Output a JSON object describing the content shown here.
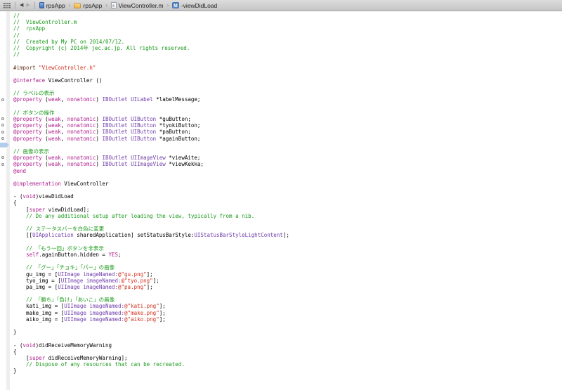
{
  "jumpbar": {
    "related_items_icon": "grid-icon",
    "back_label": "◀",
    "forward_label": "▶",
    "separator": "›",
    "file_icon_letter": "m",
    "method_icon_letter": "M",
    "breadcrumb": [
      {
        "icon": "project-icon",
        "label": "rpsApp"
      },
      {
        "icon": "folder-icon",
        "label": "rpsApp"
      },
      {
        "icon": "m-file-icon",
        "label": "ViewController.m"
      },
      {
        "icon": "method-icon",
        "label": "-viewDidLoad"
      }
    ]
  },
  "colors": {
    "comment": "#1a9a1a",
    "keyword": "#b01e8e",
    "type": "#703daa",
    "string": "#d12f1b",
    "preprocessor": "#643820",
    "plain": "#000000",
    "breakpoint_fill": "#b4ccec",
    "jumpbar_bg": "#d0d0d0"
  },
  "editor": {
    "lines": [
      {
        "s": [
          [
            "//",
            "c"
          ]
        ]
      },
      {
        "s": [
          [
            "//  ViewController.m",
            "c"
          ]
        ]
      },
      {
        "s": [
          [
            "//  rpsApp",
            "c"
          ]
        ]
      },
      {
        "s": [
          [
            "//",
            "c"
          ]
        ]
      },
      {
        "s": [
          [
            "//  Created by My PC on 2014/07/12.",
            "c"
          ]
        ]
      },
      {
        "s": [
          [
            "//  Copyright (c) 2014年 jec.ac.jp. All rights reserved.",
            "c"
          ]
        ]
      },
      {
        "s": [
          [
            "//",
            "c"
          ]
        ]
      },
      {
        "s": []
      },
      {
        "s": [
          [
            "#import ",
            "p"
          ],
          [
            "\"ViewController.h\"",
            "s"
          ]
        ]
      },
      {
        "s": []
      },
      {
        "s": [
          [
            "@interface",
            "k"
          ],
          [
            " ViewController ()",
            "n"
          ]
        ]
      },
      {
        "s": []
      },
      {
        "s": [
          [
            "// ラベルの表示",
            "c"
          ]
        ]
      },
      {
        "g": "well",
        "s": [
          [
            "@property",
            "k"
          ],
          [
            " (",
            "n"
          ],
          [
            "weak",
            "k"
          ],
          [
            ", ",
            "n"
          ],
          [
            "nonatomic",
            "k"
          ],
          [
            ") ",
            "n"
          ],
          [
            "IBOutlet",
            "t"
          ],
          [
            " ",
            "n"
          ],
          [
            "UILabel",
            "t"
          ],
          [
            " *labelMessage;",
            "n"
          ]
        ]
      },
      {
        "s": []
      },
      {
        "s": [
          [
            "// ボタンの操作",
            "c"
          ]
        ]
      },
      {
        "g": "well",
        "s": [
          [
            "@property",
            "k"
          ],
          [
            " (",
            "n"
          ],
          [
            "weak",
            "k"
          ],
          [
            ", ",
            "n"
          ],
          [
            "nonatomic",
            "k"
          ],
          [
            ") ",
            "n"
          ],
          [
            "IBOutlet",
            "t"
          ],
          [
            " ",
            "n"
          ],
          [
            "UIButton",
            "t"
          ],
          [
            " *guButton;",
            "n"
          ]
        ]
      },
      {
        "g": "well",
        "s": [
          [
            "@property",
            "k"
          ],
          [
            " (",
            "n"
          ],
          [
            "weak",
            "k"
          ],
          [
            ", ",
            "n"
          ],
          [
            "nonatomic",
            "k"
          ],
          [
            ") ",
            "n"
          ],
          [
            "IBOutlet",
            "t"
          ],
          [
            " ",
            "n"
          ],
          [
            "UIButton",
            "t"
          ],
          [
            " *tyokiButton;",
            "n"
          ]
        ]
      },
      {
        "g": "well",
        "s": [
          [
            "@property",
            "k"
          ],
          [
            " (",
            "n"
          ],
          [
            "weak",
            "k"
          ],
          [
            ", ",
            "n"
          ],
          [
            "nonatomic",
            "k"
          ],
          [
            ") ",
            "n"
          ],
          [
            "IBOutlet",
            "t"
          ],
          [
            " ",
            "n"
          ],
          [
            "UIButton",
            "t"
          ],
          [
            " *paButton;",
            "n"
          ]
        ]
      },
      {
        "g": "well",
        "s": [
          [
            "@property",
            "k"
          ],
          [
            " (",
            "n"
          ],
          [
            "weak",
            "k"
          ],
          [
            ", ",
            "n"
          ],
          [
            "nonatomic",
            "k"
          ],
          [
            ") ",
            "n"
          ],
          [
            "IBOutlet",
            "t"
          ],
          [
            " ",
            "n"
          ],
          [
            "UIButton",
            "t"
          ],
          [
            " *againButton;",
            "n"
          ]
        ]
      },
      {
        "g": "bp",
        "s": []
      },
      {
        "s": [
          [
            "// 画像の表示",
            "c"
          ]
        ]
      },
      {
        "g": "well",
        "s": [
          [
            "@property",
            "k"
          ],
          [
            " (",
            "n"
          ],
          [
            "weak",
            "k"
          ],
          [
            ", ",
            "n"
          ],
          [
            "nonatomic",
            "k"
          ],
          [
            ") ",
            "n"
          ],
          [
            "IBOutlet",
            "t"
          ],
          [
            " ",
            "n"
          ],
          [
            "UIImageView",
            "t"
          ],
          [
            " *viewAite;",
            "n"
          ]
        ]
      },
      {
        "g": "well",
        "s": [
          [
            "@property",
            "k"
          ],
          [
            " (",
            "n"
          ],
          [
            "weak",
            "k"
          ],
          [
            ", ",
            "n"
          ],
          [
            "nonatomic",
            "k"
          ],
          [
            ") ",
            "n"
          ],
          [
            "IBOutlet",
            "t"
          ],
          [
            " ",
            "n"
          ],
          [
            "UIImageView",
            "t"
          ],
          [
            " *viewKekka;",
            "n"
          ]
        ]
      },
      {
        "s": [
          [
            "@end",
            "k"
          ]
        ]
      },
      {
        "s": []
      },
      {
        "s": [
          [
            "@implementation",
            "k"
          ],
          [
            " ViewController",
            "n"
          ]
        ]
      },
      {
        "s": []
      },
      {
        "s": [
          [
            "- (",
            "n"
          ],
          [
            "void",
            "k"
          ],
          [
            ")viewDidLoad",
            "n"
          ]
        ]
      },
      {
        "s": [
          [
            "{",
            "n"
          ]
        ]
      },
      {
        "s": [
          [
            "    [",
            "n"
          ],
          [
            "super",
            "k"
          ],
          [
            " viewDidLoad];",
            "n"
          ]
        ]
      },
      {
        "s": [
          [
            "    // Do any additional setup after loading the view, typically from a nib.",
            "c"
          ]
        ]
      },
      {
        "s": []
      },
      {
        "s": [
          [
            "    // ステータスバーを白色に変更",
            "c"
          ]
        ]
      },
      {
        "s": [
          [
            "    [[",
            "n"
          ],
          [
            "UIApplication",
            "t"
          ],
          [
            " sharedApplication] setStatusBarStyle:",
            "n"
          ],
          [
            "UIStatusBarStyleLightContent",
            "t"
          ],
          [
            "];",
            "n"
          ]
        ]
      },
      {
        "s": []
      },
      {
        "s": [
          [
            "    // 「もう一回」ボタンを非表示",
            "c"
          ]
        ]
      },
      {
        "s": [
          [
            "    ",
            "n"
          ],
          [
            "self",
            "k"
          ],
          [
            ".againButton.hidden = ",
            "n"
          ],
          [
            "YES",
            "k"
          ],
          [
            ";",
            "n"
          ]
        ]
      },
      {
        "s": []
      },
      {
        "s": [
          [
            "    // 「グー」「チョキ」「パー」の画像",
            "c"
          ]
        ]
      },
      {
        "s": [
          [
            "    gu_img = [",
            "n"
          ],
          [
            "UIImage",
            "t"
          ],
          [
            " ",
            "n"
          ],
          [
            "imageNamed:",
            "t"
          ],
          [
            "@\"gu.png\"",
            "s"
          ],
          [
            "];",
            "n"
          ]
        ]
      },
      {
        "s": [
          [
            "    tyo_img = [",
            "n"
          ],
          [
            "UIImage",
            "t"
          ],
          [
            " ",
            "n"
          ],
          [
            "imageNamed:",
            "t"
          ],
          [
            "@\"tyo.png\"",
            "s"
          ],
          [
            "];",
            "n"
          ]
        ]
      },
      {
        "s": [
          [
            "    pa_img = [",
            "n"
          ],
          [
            "UIImage",
            "t"
          ],
          [
            " ",
            "n"
          ],
          [
            "imageNamed:",
            "t"
          ],
          [
            "@\"pa.png\"",
            "s"
          ],
          [
            "];",
            "n"
          ]
        ]
      },
      {
        "s": []
      },
      {
        "s": [
          [
            "    // 「勝ち」「負け」「あいこ」の画像",
            "c"
          ]
        ]
      },
      {
        "s": [
          [
            "    kati_img = [",
            "n"
          ],
          [
            "UIImage",
            "t"
          ],
          [
            " ",
            "n"
          ],
          [
            "imageNamed:",
            "t"
          ],
          [
            "@\"kati.png\"",
            "s"
          ],
          [
            "];",
            "n"
          ]
        ]
      },
      {
        "s": [
          [
            "    make_img = [",
            "n"
          ],
          [
            "UIImage",
            "t"
          ],
          [
            " ",
            "n"
          ],
          [
            "imageNamed:",
            "t"
          ],
          [
            "@\"make.png\"",
            "s"
          ],
          [
            "];",
            "n"
          ]
        ]
      },
      {
        "s": [
          [
            "    aiko_img = [",
            "n"
          ],
          [
            "UIImage",
            "t"
          ],
          [
            " ",
            "n"
          ],
          [
            "imageNamed:",
            "t"
          ],
          [
            "@\"aiko.png\"",
            "s"
          ],
          [
            "];",
            "n"
          ]
        ]
      },
      {
        "s": []
      },
      {
        "s": [
          [
            "}",
            "n"
          ]
        ]
      },
      {
        "s": []
      },
      {
        "s": [
          [
            "- (",
            "n"
          ],
          [
            "void",
            "k"
          ],
          [
            ")didReceiveMemoryWarning",
            "n"
          ]
        ]
      },
      {
        "s": [
          [
            "{",
            "n"
          ]
        ]
      },
      {
        "s": [
          [
            "    [",
            "n"
          ],
          [
            "super",
            "k"
          ],
          [
            " didReceiveMemoryWarning];",
            "n"
          ]
        ]
      },
      {
        "s": [
          [
            "    // Dispose of any resources that can be recreated.",
            "c"
          ]
        ]
      },
      {
        "s": [
          [
            "}",
            "n"
          ]
        ]
      }
    ]
  }
}
